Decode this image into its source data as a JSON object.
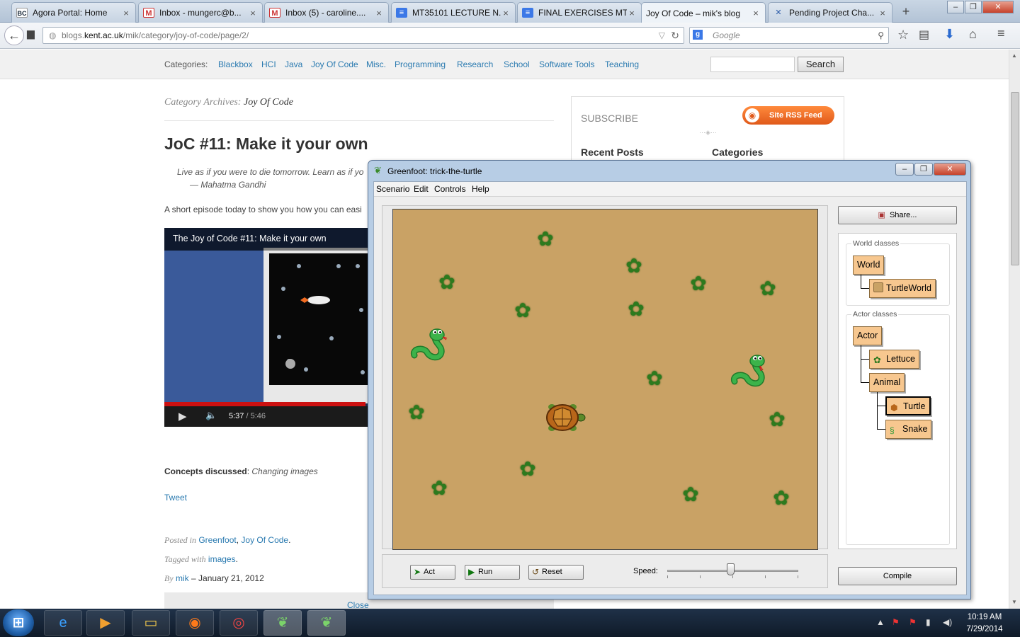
{
  "browser": {
    "tabs": [
      {
        "label": "Agora Portal: Home",
        "icon": "bc-icon",
        "icon_text": "BC"
      },
      {
        "label": "Inbox - mungerc@b...",
        "icon": "gmail-icon",
        "icon_text": "M"
      },
      {
        "label": "Inbox (5) - caroline....",
        "icon": "gmail-icon",
        "icon_text": "M"
      },
      {
        "label": "MT35101 LECTURE N...",
        "icon": "docs-icon",
        "icon_text": "≡"
      },
      {
        "label": "FINAL EXERCISES MT...",
        "icon": "docs-icon",
        "icon_text": "≡"
      },
      {
        "label": "Joy Of Code – mik's blog",
        "icon": "",
        "icon_text": ""
      },
      {
        "label": "Pending Project Cha...",
        "icon": "x-icon",
        "icon_text": "✕"
      }
    ],
    "new_tab": "+",
    "tab_close": "×",
    "url_prefix": "blogs.",
    "url_host": "kent.ac.uk",
    "url_path": "/mik/category/joy-of-code/page/2/",
    "search_placeholder": "Google",
    "window_controls": [
      "–",
      "❐",
      "✕"
    ]
  },
  "page": {
    "categories_label": "Categories:",
    "categories": [
      "Blackbox",
      "HCI",
      "Java",
      "Joy Of Code",
      "Misc.",
      "Programming",
      "Research",
      "School",
      "Software Tools",
      "Teaching"
    ],
    "search_button": "Search",
    "archive_prefix": "Category Archives:",
    "archive_name": "Joy Of Code",
    "post_title": "JoC #11: Make it your own",
    "quote_line1": "Live as if you were to die tomorrow. Learn as if yo",
    "quote_author": "— Mahatma Gandhi",
    "excerpt": "A short episode today to show you how you can easi",
    "video_title": "The Joy of Code #11: Make it your own",
    "video_time_current": "5:37",
    "video_time_total": " / 5:46",
    "video_progress": 0.98,
    "concepts_label": "Concepts discussed",
    "concepts_value": "Changing images",
    "tweet": "Tweet",
    "posted_in_label": "Posted in",
    "posted_in": [
      "Greenfoot",
      "Joy Of Code"
    ],
    "tagged_label": "Tagged with",
    "tagged": "images",
    "by_label": "By",
    "author": "mik",
    "date": "January 21, 2012",
    "close": "Close",
    "subscribe": "SUBSCRIBE",
    "rss_button": "Site RSS Feed",
    "recent_posts": "Recent Posts",
    "sidebar_categories": "Categories"
  },
  "greenfoot": {
    "title": "Greenfoot: trick-the-turtle",
    "menu": [
      "Scenario",
      "Edit",
      "Controls",
      "Help"
    ],
    "share": "Share...",
    "world_classes_label": "World classes",
    "world_classes": [
      "World",
      "TurtleWorld"
    ],
    "actor_classes_label": "Actor classes",
    "actor_classes": [
      "Actor",
      "Lettuce",
      "Animal",
      "Turtle",
      "Snake"
    ],
    "selected_class": "Turtle",
    "buttons": {
      "act": "Act",
      "run": "Run",
      "reset": "Reset"
    },
    "speed_label": "Speed:",
    "speed_value": 0.48,
    "compile": "Compile",
    "world_colors": {
      "sand": "#c9a265",
      "plant": "#2d7a1e",
      "snake": "#2f9a3a",
      "turtle_shell": "#b8661a"
    }
  },
  "taskbar": {
    "time": "10:19 AM",
    "date": "7/29/2014",
    "apps": [
      "ie-icon",
      "media-icon",
      "explorer-icon",
      "firefox-icon",
      "chrome-icon",
      "greenfoot-icon",
      "greenfoot-icon"
    ]
  }
}
